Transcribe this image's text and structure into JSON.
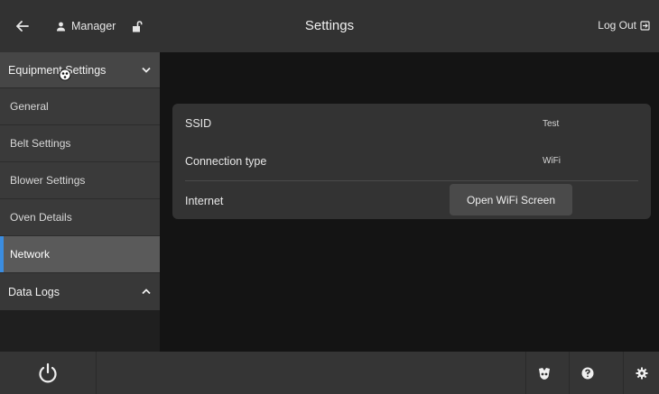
{
  "header": {
    "title": "Settings",
    "user_label": "Manager",
    "logout_label": "Log Out",
    "icons": {
      "back": "arrow-left-icon",
      "user": "person-icon",
      "lock": "unlock-icon",
      "logout": "logout-icon"
    }
  },
  "sidebar": {
    "groups": [
      {
        "label": "Equipment Settings",
        "expanded": true,
        "icon": "chevron-down-icon"
      },
      {
        "label": "Data Logs",
        "expanded": false,
        "icon": "chevron-up-icon"
      }
    ],
    "items": [
      {
        "label": "General"
      },
      {
        "label": "Belt Settings"
      },
      {
        "label": "Blower Settings"
      },
      {
        "label": "Oven Details"
      },
      {
        "label": "Network",
        "active": true
      }
    ]
  },
  "network": {
    "rows": [
      {
        "label": "SSID",
        "value": "Test"
      },
      {
        "label": "Connection type",
        "value": "WiFi"
      },
      {
        "label": "Internet",
        "button": "Open WiFi Screen"
      }
    ]
  },
  "footer": {
    "icons": [
      "power-icon",
      "cleaning-icon",
      "help-icon",
      "gear-icon"
    ]
  },
  "colors": {
    "accent": "#3b8de0",
    "header_bg": "#323232",
    "active_item_bg": "#5a5a5a"
  }
}
